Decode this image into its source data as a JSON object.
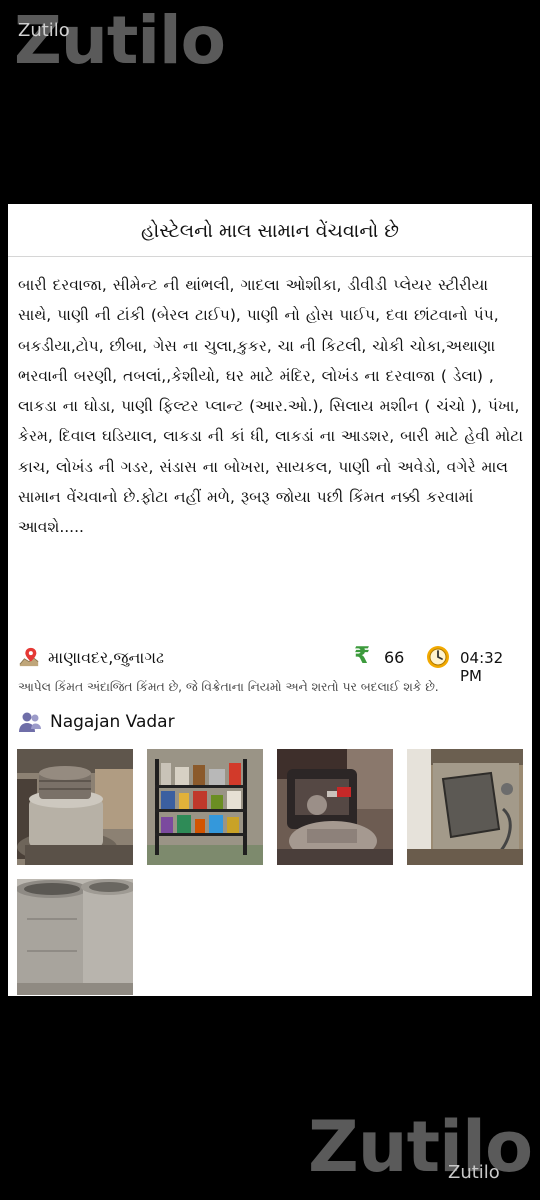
{
  "watermark": {
    "brand": "Zutilo",
    "small": "Zutilo"
  },
  "listing": {
    "title": "હોસ્ટેલનો માલ સામાન વેંચવાનો છે",
    "description": "બારી દરવાજા, સીમેન્ટ ની થાંભલી, ગાદલા ઓશીકા, ડીવીડી પ્લેયર સ્ટીરીયા સાથે, પાણી ની ટાંકી (બેરલ ટાઈપ), પાણી નો હોસ પાઈપ, દવા છાંટવાનો પંપ, બકડીયા,ટોપ, છીબા, ગેસ ના ચુલા,કુકર, ચા ની કિટલી, ચોકી ચોકા,અથાણા ભરવાની બરણી, તબલાં,,કેશીયો, ઘર માટે મંદિર, લોખંડ ના દરવાજા ( ડેલા) , લાકડા ના ઘોડા, પાણી ફિલ્ટર પ્લાન્ટ (આર.ઓ.), સિલાય મશીન ( ચંચો ), પંખા, કેરમ, દિવાલ ઘડિયાલ, લાકડા ની કાં ધી, લાકડાં ના આડશર, બારી માટે હેવી મોટા કાચ, લોખંડ ની ગડર, સંડાસ ના બોખરા, સાયકલ, પાણી નો અવેડો, વગેરે માલ સામાન વેંચવાનો છે.ફોટા નહીં મળે, રૂબરૂ જોયા પછી કિંમત નક્કી કરવામાં આવશે.....",
    "location": "માણાવદર,જુનાગઢ",
    "price_symbol": "₹",
    "price": "66",
    "time": "04:32 PM",
    "disclaimer": "આપેલ કિંમત અંદાજિત કિંમત છે, જે વિક્રેતાના નિયમો અને શરતો પર બદલાઈ શકે છે.",
    "seller": "Nagajan Vadar"
  },
  "icons": {
    "location": "map-pin-icon",
    "price": "rupee-icon",
    "time": "clock-icon",
    "seller": "user-icon"
  },
  "colors": {
    "background": "#000000",
    "card": "#ffffff",
    "pin": "#e53935",
    "rupee": "#3c9a3c",
    "clock": "#f2a900",
    "seller_icon": "#6f6ea8"
  },
  "photos": [
    "grinding-stone-photo",
    "storage-rack-photo",
    "machine-parts-photo",
    "water-filter-photo",
    "cement-barrels-photo"
  ]
}
